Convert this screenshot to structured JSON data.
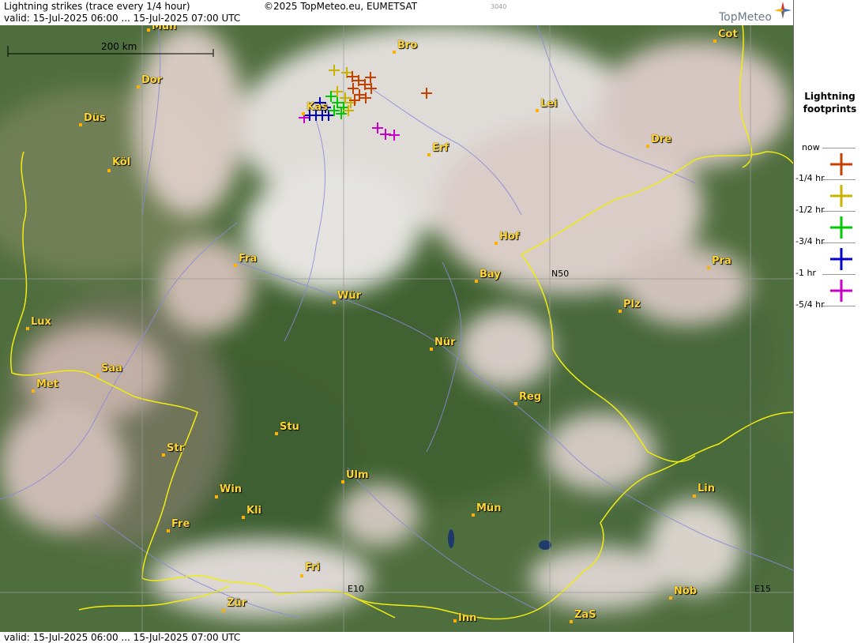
{
  "header": {
    "title": "Lightning strikes (trace every 1/4 hour)",
    "valid": "valid:  15-Jul-2025 06:00 ... 15-Jul-2025 07:00 UTC",
    "copyright": "©2025 TopMeteo.eu, EUMETSAT",
    "code": "3040",
    "brand": "TopMeteo"
  },
  "footer": {
    "valid": "valid:  15-Jul-2025 06:00 ... 15-Jul-2025 07:00 UTC"
  },
  "legend": {
    "title_line1": "Lightning",
    "title_line2": "footprints",
    "entries": [
      {
        "label": "now",
        "color": "#c84000"
      },
      {
        "label": "-1/4 hr",
        "color": "#c8b400"
      },
      {
        "label": "-1/2 hr",
        "color": "#00c800"
      },
      {
        "label": "-3/4 hr",
        "color": "#0000c8"
      },
      {
        "label": "-1 hr",
        "color": "#c800c8"
      },
      {
        "label": "-5/4 hr",
        "color": ""
      }
    ]
  },
  "scale": {
    "label": "200 km"
  },
  "grid": {
    "lat": "N50",
    "lon1": "E10",
    "lon2": "E15"
  },
  "cities": [
    {
      "name": "Mün",
      "id": "mun-top"
    },
    {
      "name": "Bro",
      "id": "bro"
    },
    {
      "name": "Cot",
      "id": "cot"
    },
    {
      "name": "Dor",
      "id": "dor"
    },
    {
      "name": "Lei",
      "id": "lei"
    },
    {
      "name": "Düs",
      "id": "dus"
    },
    {
      "name": "Kas",
      "id": "kas"
    },
    {
      "name": "Erf",
      "id": "erf"
    },
    {
      "name": "Dre",
      "id": "dre"
    },
    {
      "name": "Köl",
      "id": "kol"
    },
    {
      "name": "Hof",
      "id": "hof"
    },
    {
      "name": "Fra",
      "id": "fra"
    },
    {
      "name": "Pra",
      "id": "pra"
    },
    {
      "name": "Bay",
      "id": "bay"
    },
    {
      "name": "Wür",
      "id": "wur"
    },
    {
      "name": "Plz",
      "id": "plz"
    },
    {
      "name": "Lux",
      "id": "lux"
    },
    {
      "name": "Nür",
      "id": "nur"
    },
    {
      "name": "Saa",
      "id": "saa"
    },
    {
      "name": "Met",
      "id": "met"
    },
    {
      "name": "Reg",
      "id": "reg"
    },
    {
      "name": "Stu",
      "id": "stu"
    },
    {
      "name": "Str",
      "id": "str"
    },
    {
      "name": "Ulm",
      "id": "ulm"
    },
    {
      "name": "Win",
      "id": "win"
    },
    {
      "name": "Lin",
      "id": "lin"
    },
    {
      "name": "Kli",
      "id": "kli"
    },
    {
      "name": "Mün",
      "id": "mun"
    },
    {
      "name": "Fre",
      "id": "fre"
    },
    {
      "name": "Fri",
      "id": "fri"
    },
    {
      "name": "Nöb",
      "id": "nob"
    },
    {
      "name": "Zür",
      "id": "zur"
    },
    {
      "name": "ZaS",
      "id": "zas"
    },
    {
      "name": "Inn",
      "id": "inn"
    }
  ],
  "strike_clusters": [
    {
      "age": "now",
      "color": "#c84000"
    },
    {
      "age": "-1/4 hr",
      "color": "#c8b400"
    },
    {
      "age": "-1/2 hr",
      "color": "#00c800"
    },
    {
      "age": "-3/4 hr",
      "color": "#0000c8"
    },
    {
      "age": "-1 hr",
      "color": "#c800c8"
    }
  ]
}
